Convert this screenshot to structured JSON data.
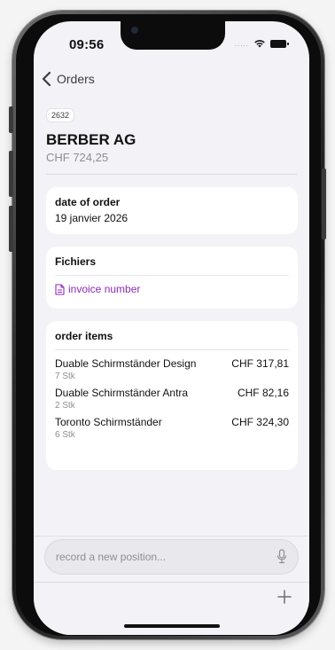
{
  "status_bar": {
    "time": "09:56",
    "signal": "....."
  },
  "nav": {
    "back_label": "Orders"
  },
  "order": {
    "number": "2632",
    "customer": "BERBER AG",
    "total": "CHF 724,25"
  },
  "date_card": {
    "title": "date of order",
    "value": "19 janvier 2026"
  },
  "files_card": {
    "title": "Fichiers",
    "file_label": "invoice number"
  },
  "items_card": {
    "title": "order items",
    "items": [
      {
        "name": "Duable Schirmständer Design",
        "qty": "7 Stk",
        "price": "CHF 317,81"
      },
      {
        "name": "Duable Schirmständer Antra",
        "qty": "2 Stk",
        "price": "CHF 82,16"
      },
      {
        "name": "Toronto Schirmständer",
        "qty": "6 Stk",
        "price": "CHF 324,30"
      }
    ]
  },
  "composer": {
    "placeholder": "record a new position..."
  },
  "colors": {
    "link": "#8b2ab8",
    "background": "#f2f2f7",
    "card": "#ffffff"
  },
  "icons": [
    "chevron-left-icon",
    "document-icon",
    "microphone-icon",
    "plus-icon",
    "wifi-icon",
    "battery-icon"
  ]
}
